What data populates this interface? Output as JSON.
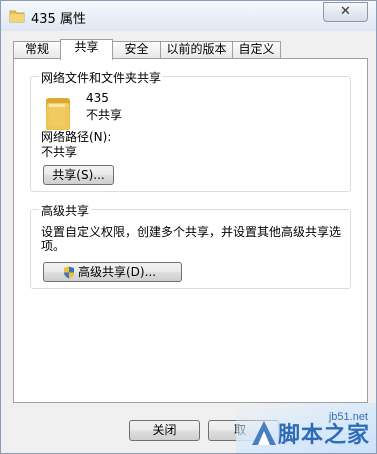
{
  "window": {
    "title": "435 属性",
    "close_glyph": "✕"
  },
  "tabs": [
    {
      "label": "常规",
      "active": false
    },
    {
      "label": "共享",
      "active": true
    },
    {
      "label": "安全",
      "active": false
    },
    {
      "label": "以前的版本",
      "active": false
    },
    {
      "label": "自定义",
      "active": false
    }
  ],
  "network_sharing": {
    "group_title": "网络文件和文件夹共享",
    "folder_name": "435",
    "folder_status": "不共享",
    "path_label": "网络路径(N):",
    "path_value": "不共享",
    "share_button": "共享(S)..."
  },
  "advanced_sharing": {
    "group_title": "高级共享",
    "description_line1": "设置自定义权限，创建多个共享，并设置其他高级共享选",
    "description_line2": "项。",
    "button": "高级共享(D)..."
  },
  "footer": {
    "close_button": "关闭",
    "cancel_button_partial": "取"
  },
  "watermark": {
    "site": "jb51.net",
    "name": "脚本之家"
  },
  "colors": {
    "folder_yellow": "#e8c14d",
    "shield_blue": "#3a73c9",
    "shield_yellow": "#f2c12e",
    "watermark_blue": "#2e6bb8"
  },
  "icons": [
    "folder-icon",
    "close-icon",
    "uac-shield-icon"
  ]
}
